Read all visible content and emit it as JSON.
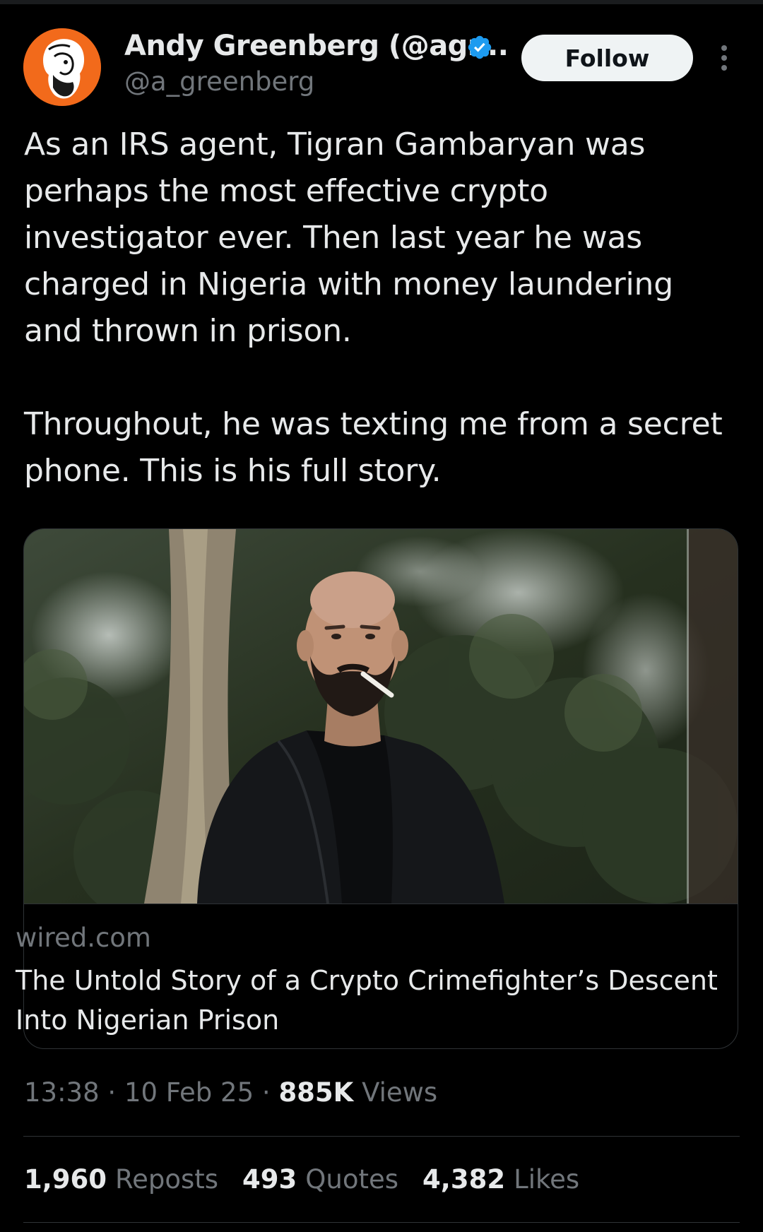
{
  "author": {
    "display_name": "Andy Greenberg (@agr...",
    "handle": "@a_greenberg",
    "verified": true,
    "avatar_icon": "bearded-man-portrait",
    "avatar_color": "#f26a1b"
  },
  "follow_label": "Follow",
  "more_icon": "more-vertical-icon",
  "tweet": {
    "paragraph_1": "As an IRS agent, Tigran Gambaryan was perhaps the most effective crypto investigator ever. Then last year he was charged in Nigeria with money laundering and thrown in prison.",
    "paragraph_2": "Throughout, he was texting me from a secret phone. This is his full story."
  },
  "link_card": {
    "domain": "wired.com",
    "title": "The Untold Story of a Crypto Crimefighter’s Descent Into Nigerian Prison"
  },
  "meta": {
    "time": "13:38",
    "date": "10 Feb 25",
    "views_count": "885K",
    "views_label": "Views",
    "separator": "·"
  },
  "stats": {
    "reposts_count": "1,960",
    "reposts_label": "Reposts",
    "quotes_count": "493",
    "quotes_label": "Quotes",
    "likes_count": "4,382",
    "likes_label": "Likes"
  },
  "colors": {
    "background": "#000000",
    "text_primary": "#e7e9ea",
    "text_secondary": "#71767b",
    "verified_blue": "#1d9bf0",
    "border": "#2f3336"
  }
}
